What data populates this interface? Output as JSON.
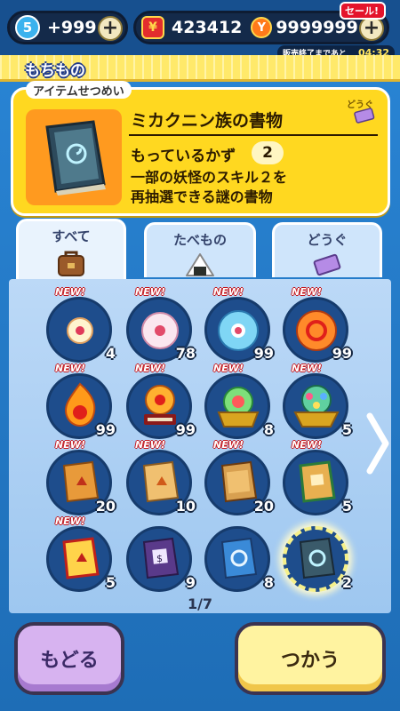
{
  "status_bar": {
    "level": "5",
    "gems": "+999",
    "money": "423412",
    "coins": "9999999",
    "sale_label": "セール!",
    "sale_timer_label": "販売終了まであと",
    "sale_timer": "04:32"
  },
  "header": {
    "title": "もちもの"
  },
  "info_panel": {
    "label": "アイテムせつめい",
    "category": "どうぐ",
    "item_name": "ミカクニン族の書物",
    "own_label": "もっているかず",
    "own_count": "2",
    "description_line1": "一部の妖怪のスキル２を",
    "description_line2": "再抽選できる謎の書物"
  },
  "tabs": [
    {
      "label": "すべて",
      "icon": "bag-icon",
      "active": true
    },
    {
      "label": "たべもの",
      "icon": "onigiri-icon",
      "active": false
    },
    {
      "label": "どうぐ",
      "icon": "ticket-icon",
      "active": false
    }
  ],
  "grid": {
    "new_badge": "NEW!",
    "items": [
      {
        "kind": "orb-small-pink",
        "qty": "4",
        "new": true
      },
      {
        "kind": "orb-pink",
        "qty": "78",
        "new": true
      },
      {
        "kind": "orb-blue",
        "qty": "99",
        "new": true
      },
      {
        "kind": "orb-red",
        "qty": "99",
        "new": true
      },
      {
        "kind": "flame-orb",
        "qty": "99",
        "new": true
      },
      {
        "kind": "orb-on-stand",
        "qty": "99",
        "new": true
      },
      {
        "kind": "rainbow-orb-gold",
        "qty": "8",
        "new": true
      },
      {
        "kind": "jewel-orb-gold",
        "qty": "5",
        "new": true
      },
      {
        "kind": "book-orange",
        "qty": "20",
        "new": true
      },
      {
        "kind": "book-tan",
        "qty": "10",
        "new": true
      },
      {
        "kind": "book-brown",
        "qty": "20",
        "new": true
      },
      {
        "kind": "book-green",
        "qty": "5",
        "new": true
      },
      {
        "kind": "book-gold-red",
        "qty": "5",
        "new": true
      },
      {
        "kind": "book-purple",
        "qty": "9",
        "new": false
      },
      {
        "kind": "book-blue",
        "qty": "8",
        "new": false
      },
      {
        "kind": "book-mystery",
        "qty": "2",
        "new": false,
        "selected": true
      }
    ]
  },
  "pager": {
    "text": "1/7"
  },
  "buttons": {
    "back": "もどる",
    "use": "つかう"
  },
  "colors": {
    "accent_yellow": "#ffd820",
    "panel_blue": "#1e4d8c",
    "back_purple": "#d7b3f0",
    "use_yellow": "#fff3a0"
  }
}
